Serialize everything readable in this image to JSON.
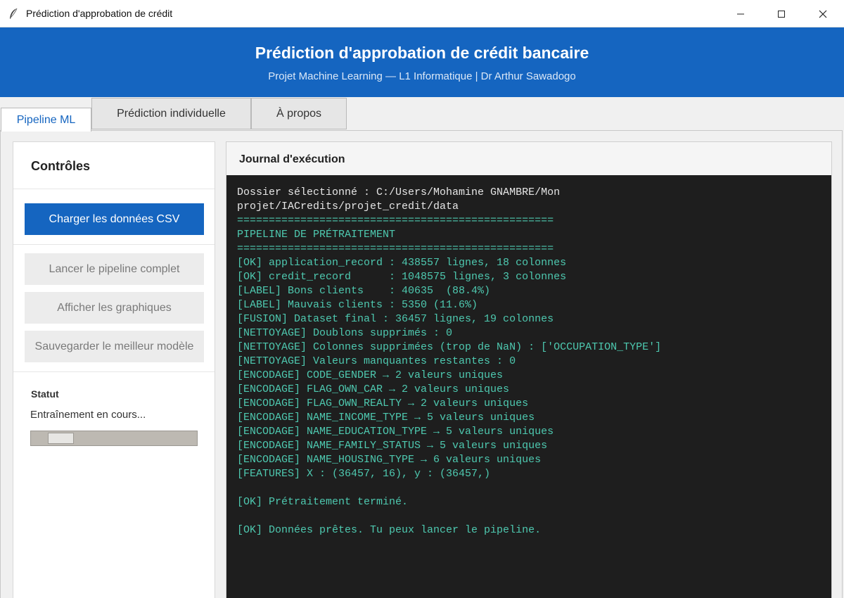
{
  "window": {
    "title": "Prédiction d'approbation de crédit"
  },
  "header": {
    "title": "Prédiction d'approbation de crédit bancaire",
    "subtitle": "Projet Machine Learning — L1 Informatique  |  Dr Arthur Sawadogo"
  },
  "tabs": [
    {
      "label": "Pipeline ML",
      "active": true
    },
    {
      "label": "Prédiction individuelle",
      "active": false
    },
    {
      "label": "À propos",
      "active": false
    }
  ],
  "controls": {
    "title": "Contrôles",
    "load_button": "Charger les données CSV",
    "run_button": "Lancer le pipeline complet",
    "charts_button": "Afficher les graphiques",
    "save_button": "Sauvegarder le meilleur modèle",
    "status_label": "Statut",
    "status_text": "Entraînement en cours..."
  },
  "journal": {
    "title": "Journal d'exécution",
    "lines": [
      {
        "text": "Dossier sélectionné : C:/Users/Mohamine GNAMBRE/Mon",
        "color": "white"
      },
      {
        "text": "projet/IACredits/projet_credit/data",
        "color": "white"
      },
      {
        "text": "==================================================",
        "color": "green"
      },
      {
        "text": "PIPELINE DE PRÉTRAITEMENT",
        "color": "green"
      },
      {
        "text": "==================================================",
        "color": "green"
      },
      {
        "text": "[OK] application_record : 438557 lignes, 18 colonnes",
        "color": "green"
      },
      {
        "text": "[OK] credit_record      : 1048575 lignes, 3 colonnes",
        "color": "green"
      },
      {
        "text": "[LABEL] Bons clients    : 40635  (88.4%)",
        "color": "green"
      },
      {
        "text": "[LABEL] Mauvais clients : 5350 (11.6%)",
        "color": "green"
      },
      {
        "text": "[FUSION] Dataset final : 36457 lignes, 19 colonnes",
        "color": "green"
      },
      {
        "text": "[NETTOYAGE] Doublons supprimés : 0",
        "color": "green"
      },
      {
        "text": "[NETTOYAGE] Colonnes supprimées (trop de NaN) : ['OCCUPATION_TYPE']",
        "color": "green"
      },
      {
        "text": "[NETTOYAGE] Valeurs manquantes restantes : 0",
        "color": "green"
      },
      {
        "text": "[ENCODAGE] CODE_GENDER → 2 valeurs uniques",
        "color": "green"
      },
      {
        "text": "[ENCODAGE] FLAG_OWN_CAR → 2 valeurs uniques",
        "color": "green"
      },
      {
        "text": "[ENCODAGE] FLAG_OWN_REALTY → 2 valeurs uniques",
        "color": "green"
      },
      {
        "text": "[ENCODAGE] NAME_INCOME_TYPE → 5 valeurs uniques",
        "color": "green"
      },
      {
        "text": "[ENCODAGE] NAME_EDUCATION_TYPE → 5 valeurs uniques",
        "color": "green"
      },
      {
        "text": "[ENCODAGE] NAME_FAMILY_STATUS → 5 valeurs uniques",
        "color": "green"
      },
      {
        "text": "[ENCODAGE] NAME_HOUSING_TYPE → 6 valeurs uniques",
        "color": "green"
      },
      {
        "text": "[FEATURES] X : (36457, 16), y : (36457,)",
        "color": "green"
      },
      {
        "text": "",
        "color": "green"
      },
      {
        "text": "[OK] Prétraitement terminé.",
        "color": "green"
      },
      {
        "text": "",
        "color": "green"
      },
      {
        "text": "[OK] Données prêtes. Tu peux lancer le pipeline.",
        "color": "green"
      }
    ]
  },
  "colors": {
    "accent": "#1565c0",
    "console_bg": "#1e1e1e",
    "console_text": "#4ec9b0"
  }
}
